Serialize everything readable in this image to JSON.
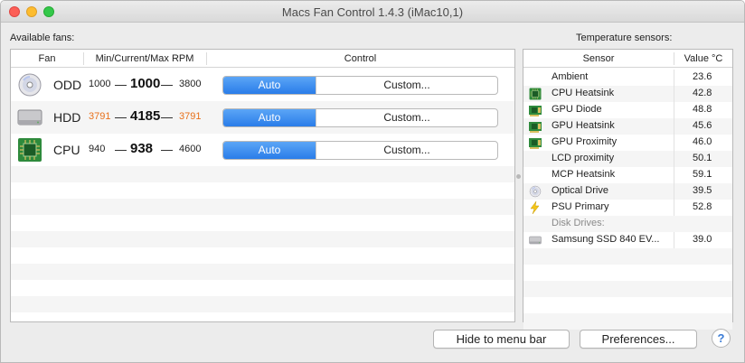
{
  "window": {
    "title": "Macs Fan Control 1.4.3 (iMac10,1)"
  },
  "fans": {
    "section_label": "Available fans:",
    "columns": {
      "fan": "Fan",
      "rpm": "Min/Current/Max RPM",
      "control": "Control"
    },
    "dash": "—",
    "rows": [
      {
        "name": "ODD",
        "icon": "optical-drive-icon",
        "min": "1000",
        "current": "1000",
        "max": "3800",
        "warn": false,
        "auto_label": "Auto",
        "custom_label": "Custom..."
      },
      {
        "name": "HDD",
        "icon": "hard-drive-icon",
        "min": "3791",
        "current": "4185",
        "max": "3791",
        "warn": true,
        "auto_label": "Auto",
        "custom_label": "Custom..."
      },
      {
        "name": "CPU",
        "icon": "cpu-chip-icon",
        "min": "940",
        "current": "938",
        "max": "4600",
        "warn": false,
        "auto_label": "Auto",
        "custom_label": "Custom..."
      }
    ]
  },
  "sensors": {
    "section_label": "Temperature sensors:",
    "columns": {
      "sensor": "Sensor",
      "value": "Value °C"
    },
    "rows": [
      {
        "name": "Ambient",
        "value": "23.6",
        "icon": ""
      },
      {
        "name": "CPU Heatsink",
        "value": "42.8",
        "icon": "cpu-chip-icon"
      },
      {
        "name": "GPU Diode",
        "value": "48.8",
        "icon": "gpu-card-icon"
      },
      {
        "name": "GPU Heatsink",
        "value": "45.6",
        "icon": "gpu-card-icon"
      },
      {
        "name": "GPU Proximity",
        "value": "46.0",
        "icon": "gpu-card-icon"
      },
      {
        "name": "LCD proximity",
        "value": "50.1",
        "icon": ""
      },
      {
        "name": "MCP Heatsink",
        "value": "59.1",
        "icon": ""
      },
      {
        "name": "Optical Drive",
        "value": "39.5",
        "icon": "optical-drive-icon"
      },
      {
        "name": "PSU Primary",
        "value": "52.8",
        "icon": "lightning-icon"
      },
      {
        "name": "Disk Drives:",
        "value": "",
        "icon": "",
        "group": true
      },
      {
        "name": "Samsung SSD 840 EV...",
        "value": "39.0",
        "icon": "hard-drive-icon"
      }
    ]
  },
  "footer": {
    "hide_label": "Hide to menu bar",
    "preferences_label": "Preferences...",
    "help_label": "?"
  },
  "colors": {
    "accent_blue": "#2a7de9",
    "warning_orange": "#e8701b"
  }
}
